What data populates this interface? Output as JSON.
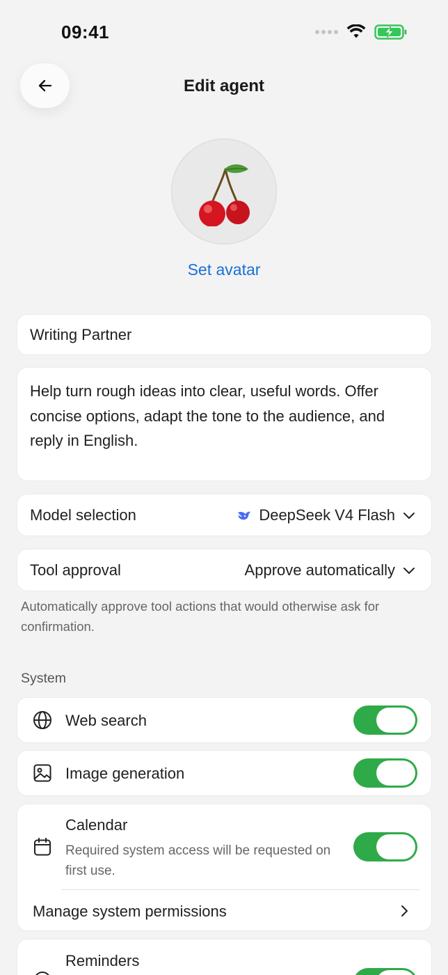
{
  "status_bar": {
    "time": "09:41"
  },
  "header": {
    "title": "Edit agent"
  },
  "avatar": {
    "action_label": "Set avatar"
  },
  "agent": {
    "name": "Writing Partner",
    "description": "Help turn rough ideas into clear, useful words. Offer concise options, adapt the tone to the audience, and reply in English."
  },
  "model_selection": {
    "label": "Model selection",
    "value": "DeepSeek V4 Flash"
  },
  "tool_approval": {
    "label": "Tool approval",
    "value": "Approve automatically",
    "helper": "Automatically approve tool actions that would otherwise ask for confirmation."
  },
  "system": {
    "section_title": "System",
    "items": [
      {
        "label": "Web search",
        "icon": "globe-icon",
        "enabled": true
      },
      {
        "label": "Image generation",
        "icon": "image-icon",
        "enabled": true
      },
      {
        "label": "Calendar",
        "icon": "calendar-icon",
        "enabled": true,
        "subtitle": "Required system access will be requested on first use.",
        "link_label": "Manage system permissions"
      },
      {
        "label": "Reminders",
        "icon": "reminders-icon",
        "enabled": true
      }
    ]
  },
  "colors": {
    "accent_blue": "#1a6fd6",
    "toggle_on": "#2faa48",
    "battery": "#35c759",
    "background": "#f3f3f3"
  }
}
